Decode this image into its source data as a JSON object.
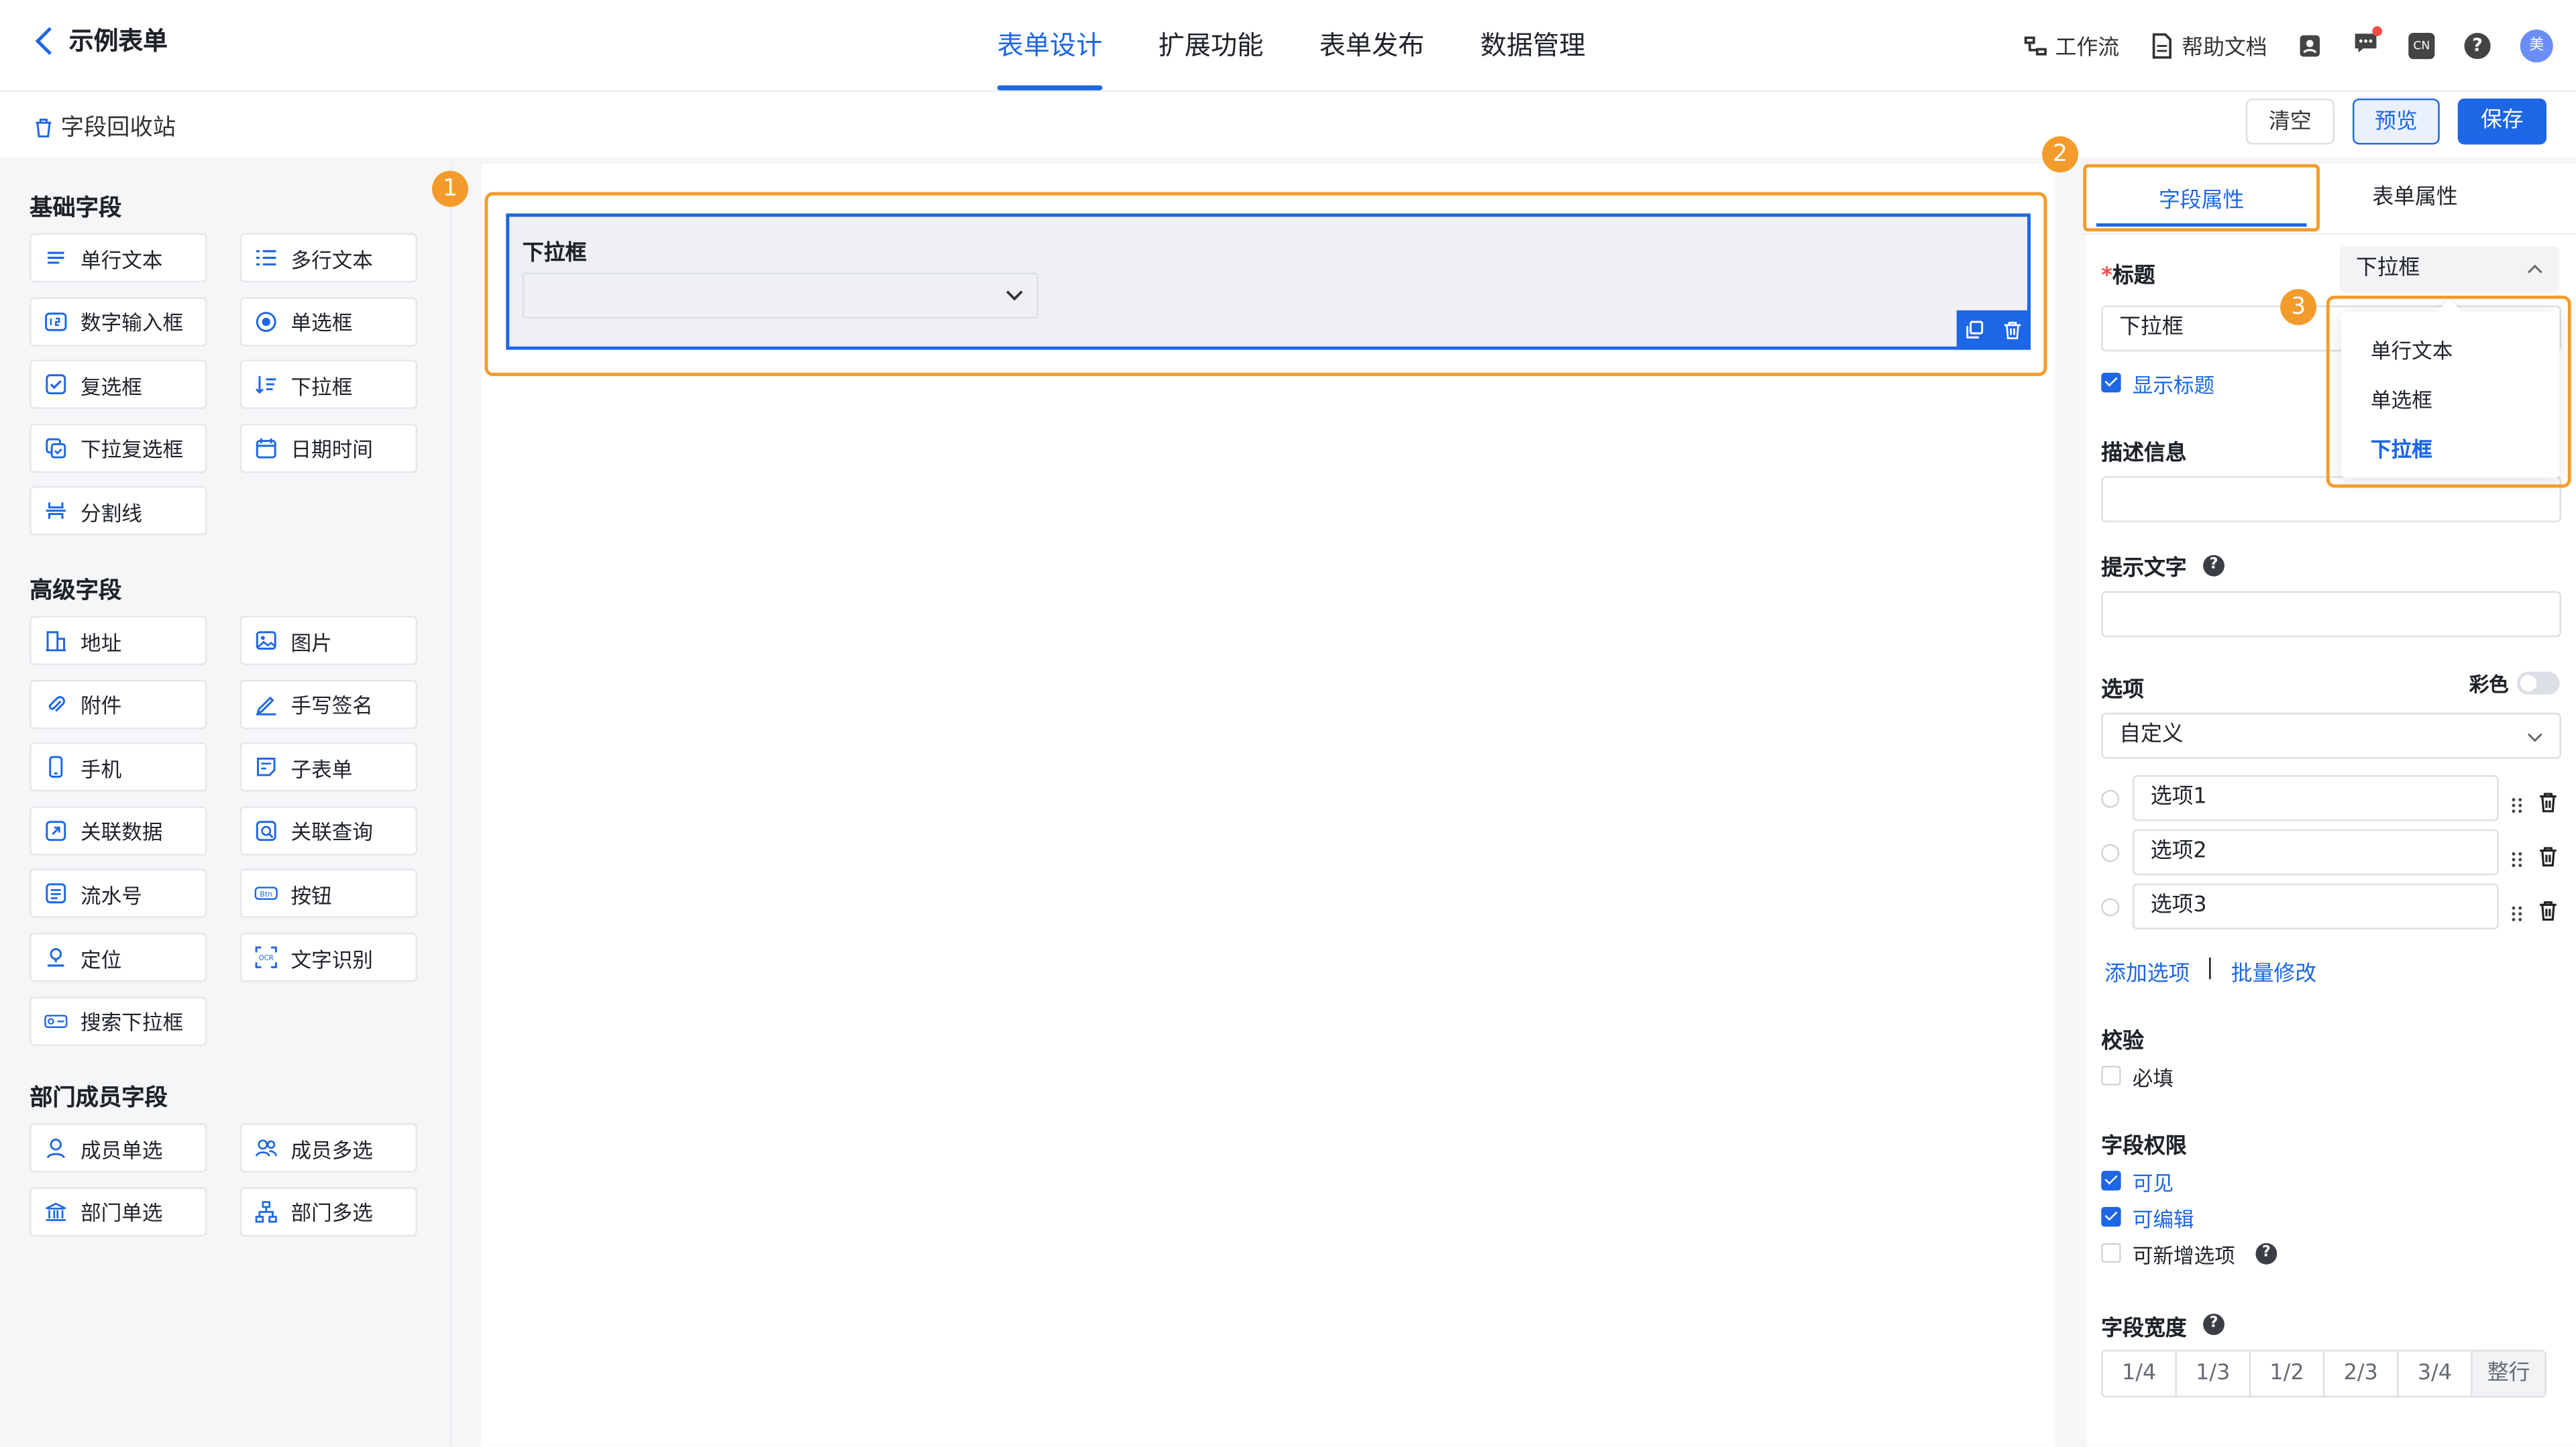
{
  "header": {
    "back_title": "示例表单",
    "tabs": [
      "表单设计",
      "扩展功能",
      "表单发布",
      "数据管理"
    ],
    "active_tab": "表单设计",
    "workflow": "工作流",
    "help_docs": "帮助文档",
    "lang": "CN",
    "avatar": "美"
  },
  "toolbar": {
    "recycle_bin": "字段回收站",
    "clear": "清空",
    "preview": "预览",
    "save": "保存"
  },
  "left": {
    "basic_title": "基础字段",
    "basic": [
      {
        "label": "单行文本",
        "icon": "single-line-text-icon"
      },
      {
        "label": "多行文本",
        "icon": "multi-line-text-icon"
      },
      {
        "label": "数字输入框",
        "icon": "number-input-icon"
      },
      {
        "label": "单选框",
        "icon": "radio-icon"
      },
      {
        "label": "复选框",
        "icon": "checkbox-icon"
      },
      {
        "label": "下拉框",
        "icon": "dropdown-icon"
      },
      {
        "label": "下拉复选框",
        "icon": "dropdown-checkbox-icon"
      },
      {
        "label": "日期时间",
        "icon": "calendar-icon"
      },
      {
        "label": "分割线",
        "icon": "divider-icon"
      }
    ],
    "advanced_title": "高级字段",
    "advanced": [
      {
        "label": "地址",
        "icon": "address-icon"
      },
      {
        "label": "图片",
        "icon": "image-icon"
      },
      {
        "label": "附件",
        "icon": "attachment-icon"
      },
      {
        "label": "手写签名",
        "icon": "signature-icon"
      },
      {
        "label": "手机",
        "icon": "phone-icon"
      },
      {
        "label": "子表单",
        "icon": "subform-icon"
      },
      {
        "label": "关联数据",
        "icon": "linked-data-icon"
      },
      {
        "label": "关联查询",
        "icon": "linked-query-icon"
      },
      {
        "label": "流水号",
        "icon": "serial-number-icon"
      },
      {
        "label": "按钮",
        "icon": "button-icon"
      },
      {
        "label": "定位",
        "icon": "location-icon"
      },
      {
        "label": "文字识别",
        "icon": "ocr-icon"
      },
      {
        "label": "搜索下拉框",
        "icon": "search-dropdown-icon"
      }
    ],
    "dept_title": "部门成员字段",
    "dept": [
      {
        "label": "成员单选",
        "icon": "member-single-icon"
      },
      {
        "label": "成员多选",
        "icon": "member-multi-icon"
      },
      {
        "label": "部门单选",
        "icon": "dept-single-icon"
      },
      {
        "label": "部门多选",
        "icon": "dept-multi-icon"
      }
    ]
  },
  "canvas": {
    "field_label": "下拉框",
    "badge1": "1"
  },
  "right": {
    "badge2": "2",
    "badge3": "3",
    "tab_field": "字段属性",
    "tab_form": "表单属性",
    "title_label": "标题",
    "title_required": "*",
    "title_type": "下拉框",
    "title_value": "下拉框",
    "show_title": "显示标题",
    "type_options": [
      "单行文本",
      "单选框",
      "下拉框"
    ],
    "desc_label": "描述信息",
    "hint_label": "提示文字",
    "options_label": "选项",
    "color_label": "彩色",
    "options_source": "自定义",
    "options": [
      "选项1",
      "选项2",
      "选项3"
    ],
    "add_option": "添加选项",
    "separator": "|",
    "batch_edit": "批量修改",
    "validate_label": "校验",
    "required": "必填",
    "perm_label": "字段权限",
    "visible": "可见",
    "editable": "可编辑",
    "can_add_option": "可新增选项",
    "width_label": "字段宽度",
    "widths": [
      "1/4",
      "1/3",
      "1/2",
      "2/3",
      "3/4",
      "整行"
    ]
  }
}
